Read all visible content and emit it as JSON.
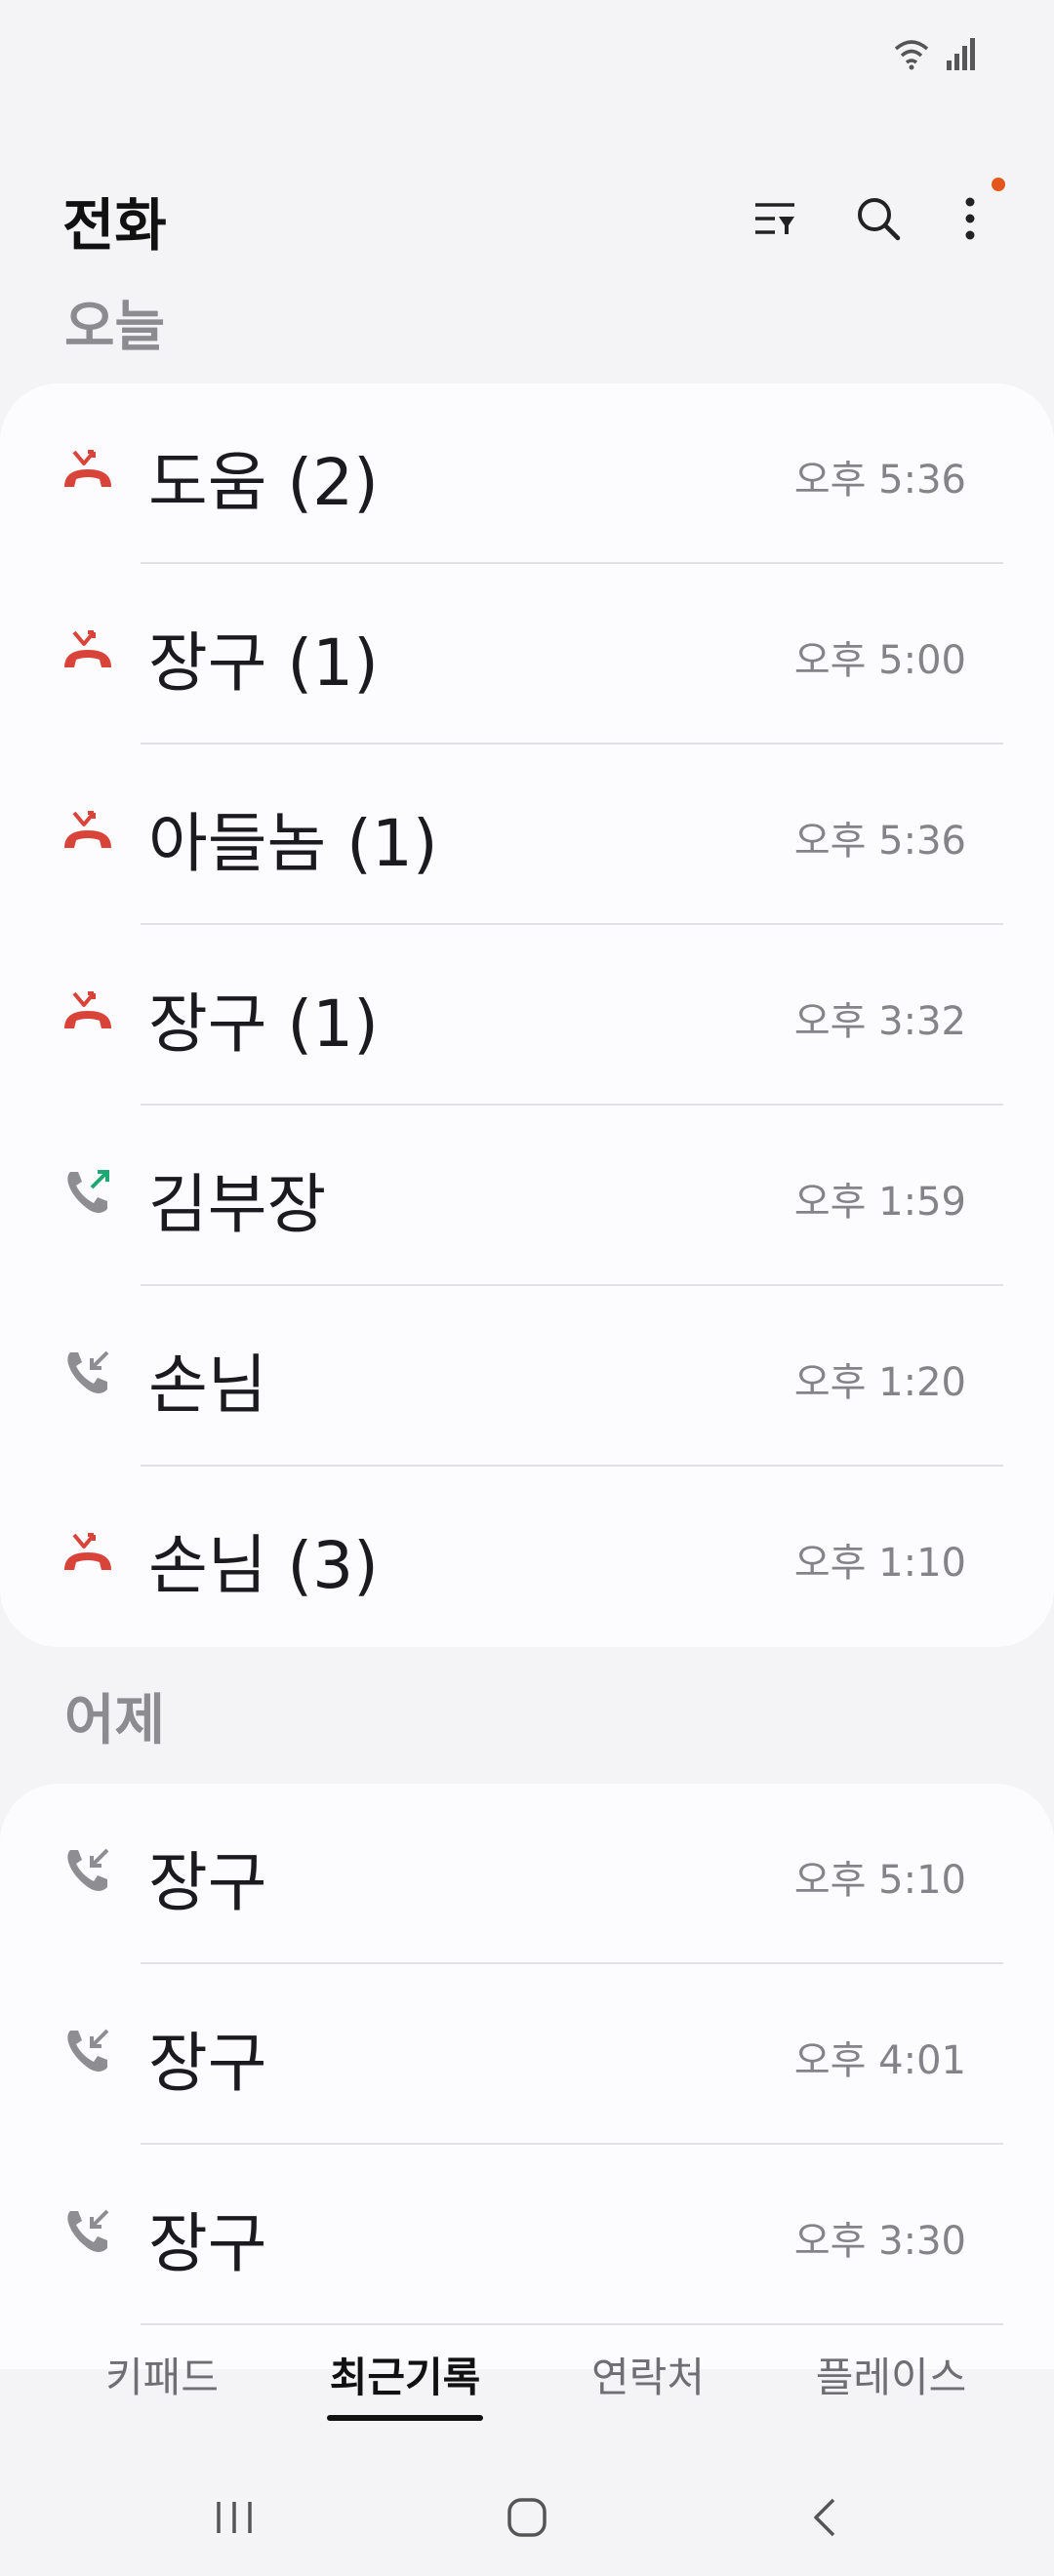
{
  "app": {
    "title": "전화"
  },
  "status_icons": [
    "wifi-icon",
    "signal-icon"
  ],
  "header": {
    "filter_icon": "filter-icon",
    "search_icon": "search-icon",
    "more_icon": "more-vertical-icon",
    "notification_color": "#e4571c"
  },
  "sections": [
    {
      "title": "오늘",
      "calls": [
        {
          "name": "도움 (2)",
          "time": "오후 5:36",
          "type": "missed"
        },
        {
          "name": "장구 (1)",
          "time": "오후 5:00",
          "type": "missed"
        },
        {
          "name": "아들놈 (1)",
          "time": "오후 5:36",
          "type": "missed"
        },
        {
          "name": "장구 (1)",
          "time": "오후 3:32",
          "type": "missed"
        },
        {
          "name": "김부장",
          "time": "오후 1:59",
          "type": "outgoing"
        },
        {
          "name": "손님",
          "time": "오후 1:20",
          "type": "incoming"
        },
        {
          "name": "손님 (3)",
          "time": "오후 1:10",
          "type": "missed"
        }
      ]
    },
    {
      "title": "어제",
      "calls": [
        {
          "name": "장구",
          "time": "오후 5:10",
          "type": "incoming"
        },
        {
          "name": "장구",
          "time": "오후 4:01",
          "type": "incoming"
        },
        {
          "name": "장구",
          "time": "오후 3:30",
          "type": "incoming"
        }
      ]
    }
  ],
  "tabs": [
    {
      "label": "키패드",
      "active": false
    },
    {
      "label": "최근기록",
      "active": true
    },
    {
      "label": "연락처",
      "active": false
    },
    {
      "label": "플레이스",
      "active": false
    }
  ],
  "nav": [
    "recent-apps-icon",
    "home-icon",
    "back-icon"
  ],
  "colors": {
    "missed": "#d9443a",
    "outgoing": "#1fa874",
    "incoming": "#8d8d92"
  }
}
